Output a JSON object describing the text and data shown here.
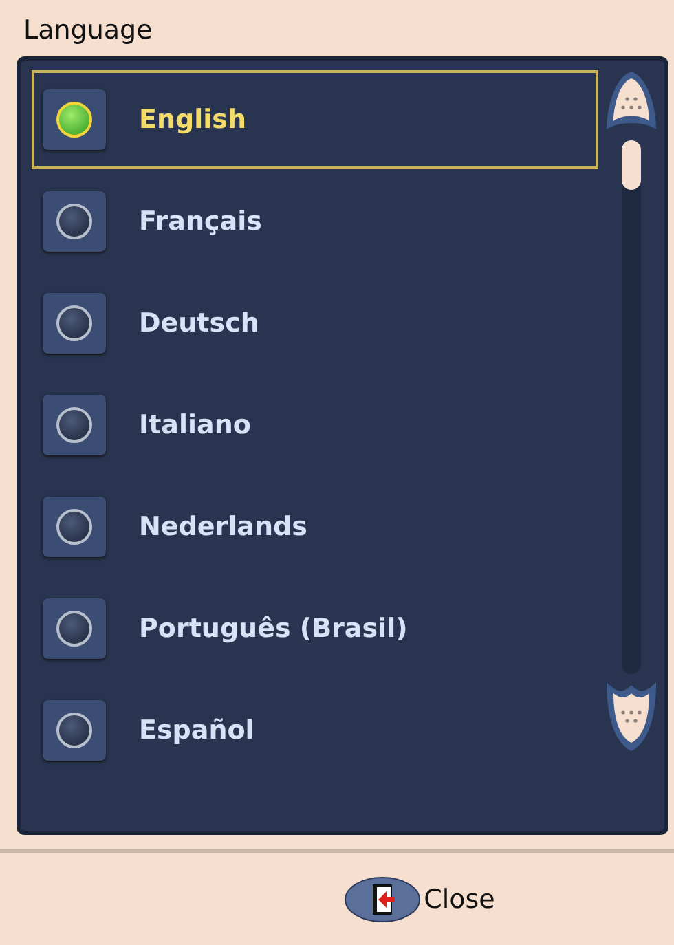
{
  "window": {
    "title": "Language"
  },
  "languages": [
    {
      "label": "English",
      "selected": true
    },
    {
      "label": "Français",
      "selected": false
    },
    {
      "label": "Deutsch",
      "selected": false
    },
    {
      "label": "Italiano",
      "selected": false
    },
    {
      "label": "Nederlands",
      "selected": false
    },
    {
      "label": "Português (Brasil)",
      "selected": false
    },
    {
      "label": "Español",
      "selected": false
    }
  ],
  "buttons": [
    {
      "label": "Close"
    }
  ]
}
